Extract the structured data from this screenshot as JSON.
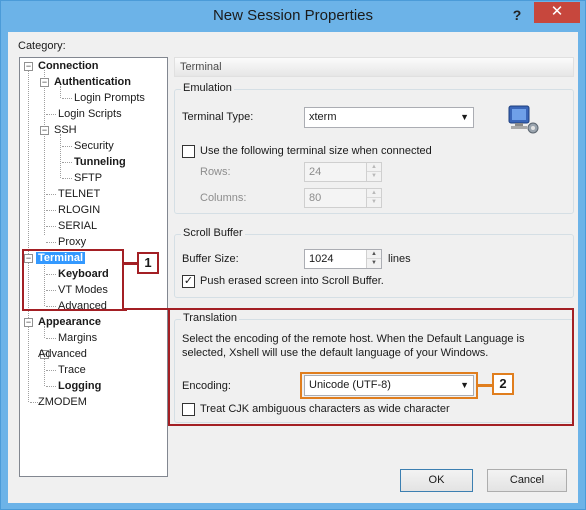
{
  "window": {
    "title": "New Session Properties",
    "help_glyph": "?",
    "close_glyph": "✕"
  },
  "category": {
    "label": "Category:",
    "tree": [
      {
        "label": "Connection",
        "bold": true
      },
      {
        "label": "Authentication",
        "bold": true
      },
      {
        "label": "Login Prompts",
        "bold": false
      },
      {
        "label": "Login Scripts",
        "bold": false
      },
      {
        "label": "SSH",
        "bold": false
      },
      {
        "label": "Security",
        "bold": false
      },
      {
        "label": "Tunneling",
        "bold": true
      },
      {
        "label": "SFTP",
        "bold": false
      },
      {
        "label": "TELNET",
        "bold": false
      },
      {
        "label": "RLOGIN",
        "bold": false
      },
      {
        "label": "SERIAL",
        "bold": false
      },
      {
        "label": "Proxy",
        "bold": false
      },
      {
        "label": "Terminal",
        "bold": true,
        "selected": true
      },
      {
        "label": "Keyboard",
        "bold": true
      },
      {
        "label": "VT Modes",
        "bold": false
      },
      {
        "label": "Advanced",
        "bold": false
      },
      {
        "label": "Appearance",
        "bold": true
      },
      {
        "label": "Margins",
        "bold": false
      },
      {
        "label": "Advanced",
        "bold": false
      },
      {
        "label": "Trace",
        "bold": false
      },
      {
        "label": "Logging",
        "bold": true
      },
      {
        "label": "ZMODEM",
        "bold": false
      }
    ]
  },
  "panel": {
    "header": "Terminal",
    "emulation": {
      "title": "Emulation",
      "terminal_type_label": "Terminal Type:",
      "terminal_type_value": "xterm",
      "custom_size_label": "Use the following terminal size when connected",
      "custom_size_checked": false,
      "rows_label": "Rows:",
      "rows_value": "24",
      "columns_label": "Columns:",
      "columns_value": "80"
    },
    "scroll_buffer": {
      "title": "Scroll Buffer",
      "buffer_size_label": "Buffer Size:",
      "buffer_size_value": "1024",
      "lines_label": "lines",
      "push_erased_label": "Push erased screen into Scroll Buffer.",
      "push_erased_checked": true
    },
    "translation": {
      "title": "Translation",
      "description_line1": "Select the encoding of the remote host. When the Default Language is",
      "description_line2": "selected, Xshell will use the default language of your Windows.",
      "encoding_label": "Encoding:",
      "encoding_value": "Unicode (UTF-8)",
      "cjk_label": "Treat CJK ambiguous characters as wide character",
      "cjk_checked": false
    }
  },
  "buttons": {
    "ok": "OK",
    "cancel": "Cancel"
  },
  "callouts": {
    "one": "1",
    "two": "2"
  },
  "colors": {
    "title_bar": "#6cb3e8",
    "selection": "#3399ff",
    "callout_red": "#a31f24",
    "callout_orange": "#e07e1e",
    "close_button": "#c7473d"
  }
}
